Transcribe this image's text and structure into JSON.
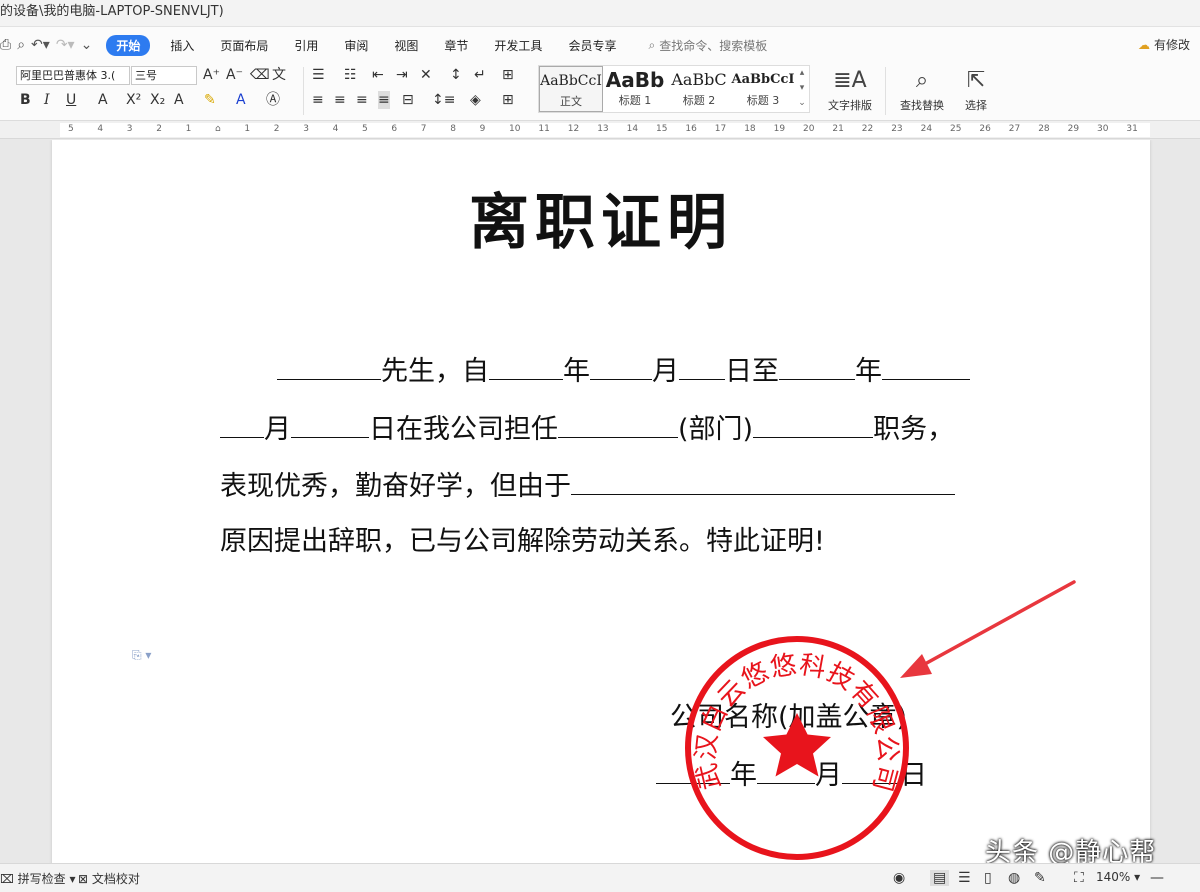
{
  "window": {
    "title": "的设备\\我的电脑-LAPTOP-SNENVLJT)"
  },
  "menu": {
    "tabs": [
      "开始",
      "插入",
      "页面布局",
      "引用",
      "审阅",
      "视图",
      "章节",
      "开发工具",
      "会员专享"
    ],
    "search_placeholder": "查找命令、搜索模板",
    "modify_label": "有修改"
  },
  "ribbon": {
    "font_name": "阿里巴巴普惠体 3.(",
    "font_size": "三号",
    "styles": [
      {
        "sample": "AaBbCcI",
        "label": "正文"
      },
      {
        "sample": "AaBb",
        "label": "标题 1"
      },
      {
        "sample": "AaBbC",
        "label": "标题 2"
      },
      {
        "sample": "AaBbCcI",
        "label": "标题 3"
      }
    ],
    "text_layout": "文字排版",
    "find_replace": "查找替换",
    "select": "选择"
  },
  "ruler": {
    "ticks": [
      "5",
      "4",
      "3",
      "2",
      "1",
      "",
      "1",
      "2",
      "3",
      "4",
      "5",
      "6",
      "7",
      "8",
      "9",
      "10",
      "11",
      "12",
      "13",
      "14",
      "15",
      "16",
      "17",
      "18",
      "19",
      "20",
      "21",
      "22",
      "23",
      "24",
      "25",
      "26",
      "27",
      "28",
      "29",
      "30",
      "31"
    ]
  },
  "doc": {
    "title": "离职证明",
    "line1": {
      "a": "先生，自",
      "b": "年",
      "c": "月",
      "d": "日至",
      "e": "年"
    },
    "line2": {
      "a": "月",
      "b": "日在我公司担任",
      "c": "(部门)",
      "d": "职务，"
    },
    "line3": {
      "a": "表现优秀，勤奋好学，但由于"
    },
    "line4": {
      "a": "原因提出辞职，已与公司解除劳动关系。特此证明!"
    },
    "company": "公司名称(加盖公章)",
    "date": {
      "y": "年",
      "m": "月",
      "d": "日"
    }
  },
  "seal": {
    "text": "武汉白云悠悠科技有限公司",
    "color": "#e8141c"
  },
  "watermark": "头条 @静心帮",
  "status": {
    "spell": "拼写检查",
    "proof": "文档校对",
    "zoom": "140%"
  }
}
